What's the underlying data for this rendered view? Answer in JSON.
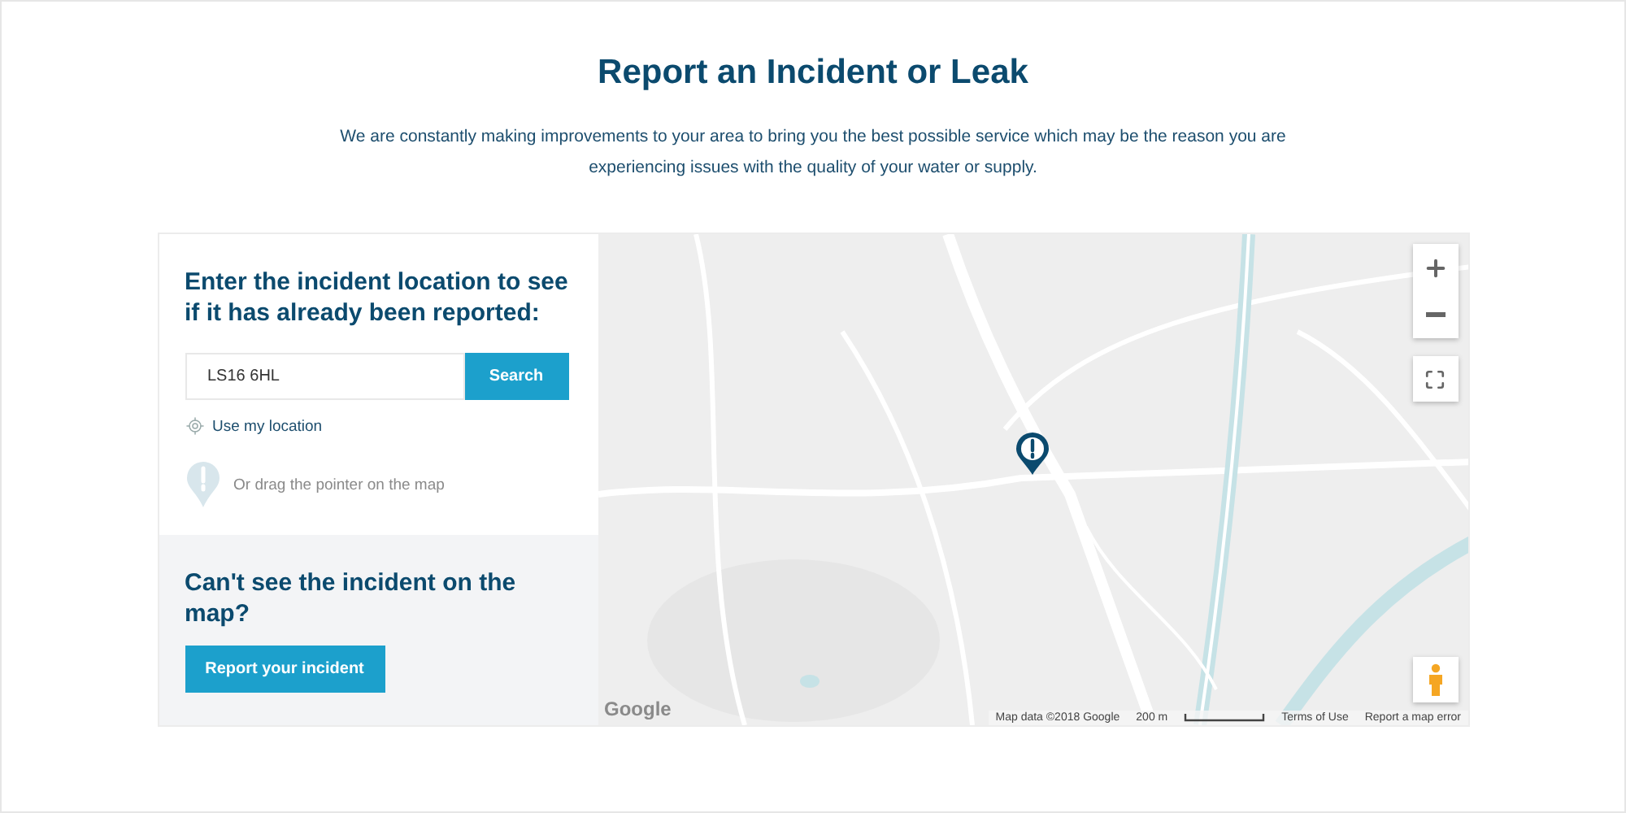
{
  "title": "Report an Incident or Leak",
  "intro": "We are constantly making improvements to your area to bring you the best possible service which may be the reason you are experiencing issues with the quality of your water or supply.",
  "search_panel": {
    "heading": "Enter the incident location to see if it has already been reported:",
    "field": {
      "value": "LS16 6HL"
    },
    "button": "Search",
    "location_link": "Use my location",
    "drag_hint": "Or drag the pointer on the map"
  },
  "report_panel": {
    "heading": "Can't see the incident on the map?",
    "button": "Report your incident"
  },
  "map": {
    "kind": "picture",
    "logo": "Google",
    "attribution": "Map data ©2018 Google",
    "scale": "200 m",
    "links": [
      "Terms of Use",
      "Report a map error"
    ]
  }
}
